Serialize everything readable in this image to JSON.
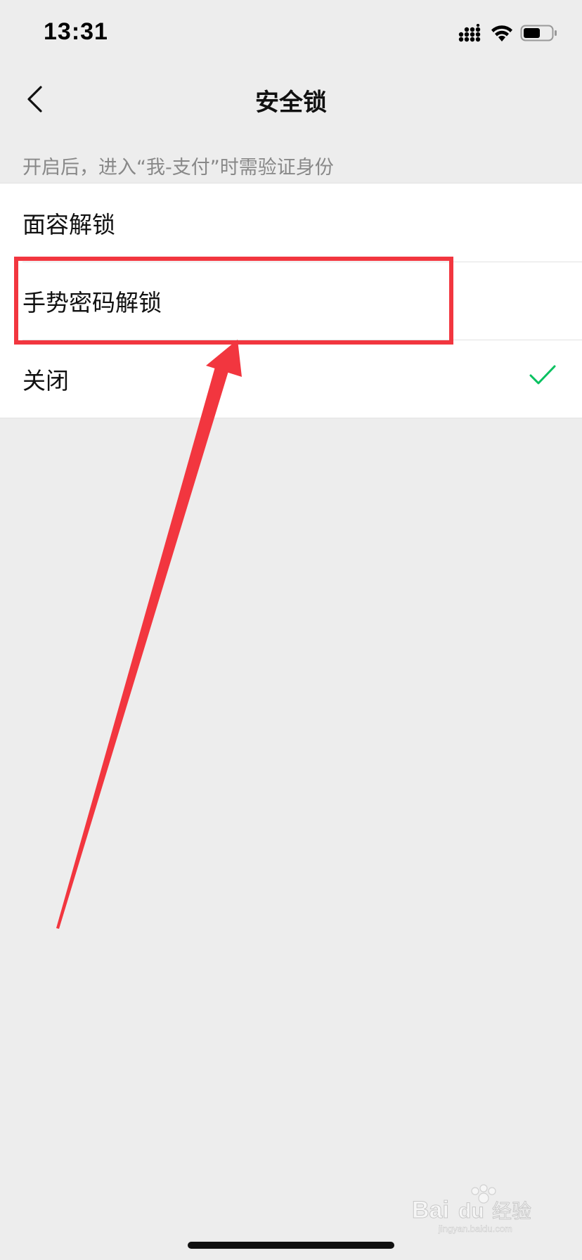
{
  "status_bar": {
    "time": "13:31",
    "icons": [
      "signal-icon",
      "wifi-icon",
      "battery-icon"
    ]
  },
  "nav": {
    "back_icon": "chevron-left-icon",
    "title": "安全锁"
  },
  "section": {
    "description": "开启后，进入“我-支付”时需验证身份"
  },
  "options": [
    {
      "label": "面容解锁",
      "selected": false
    },
    {
      "label": "手势密码解锁",
      "selected": false,
      "highlighted": true
    },
    {
      "label": "关闭",
      "selected": true
    }
  ],
  "colors": {
    "background": "#ededed",
    "card": "#ffffff",
    "check": "#07c160",
    "annotation": "#f2363f",
    "muted_text": "#888888"
  },
  "watermark": {
    "brand": "Bai du 经验",
    "url": "jingyan.baidu.com"
  }
}
